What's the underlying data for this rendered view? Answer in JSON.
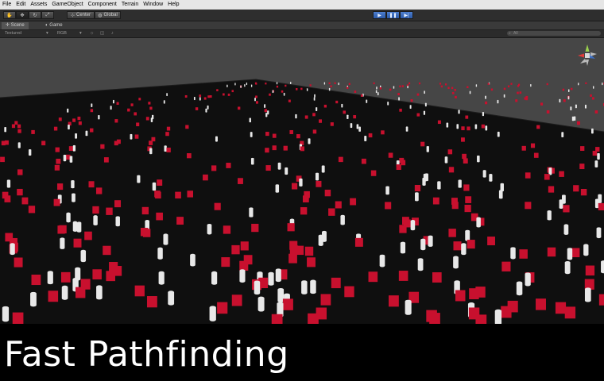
{
  "menu": {
    "items": [
      "File",
      "Edit",
      "Assets",
      "GameObject",
      "Component",
      "Terrain",
      "Window",
      "Help"
    ]
  },
  "toolbar": {
    "hand_icon": "hand-icon",
    "move_icon": "move-icon",
    "rotate_icon": "rotate-icon",
    "scale_icon": "scale-icon",
    "pivot_label": "Center",
    "space_label": "Global",
    "play_icon": "play-icon",
    "pause_icon": "pause-icon",
    "step_icon": "step-icon"
  },
  "tabs": {
    "scene": "Scene",
    "game": "Game"
  },
  "scene_bar": {
    "render_mode": "Textured",
    "color_mode": "RGB",
    "search_placeholder": "All"
  },
  "caption": {
    "title": "Fast Pathfinding"
  },
  "colors": {
    "agent_red": "#c8102e",
    "obstacle_white": "#e8e8e8",
    "ground": "#0f0f0f",
    "sky": "#464646",
    "play_blue": "#3a6cc0"
  }
}
